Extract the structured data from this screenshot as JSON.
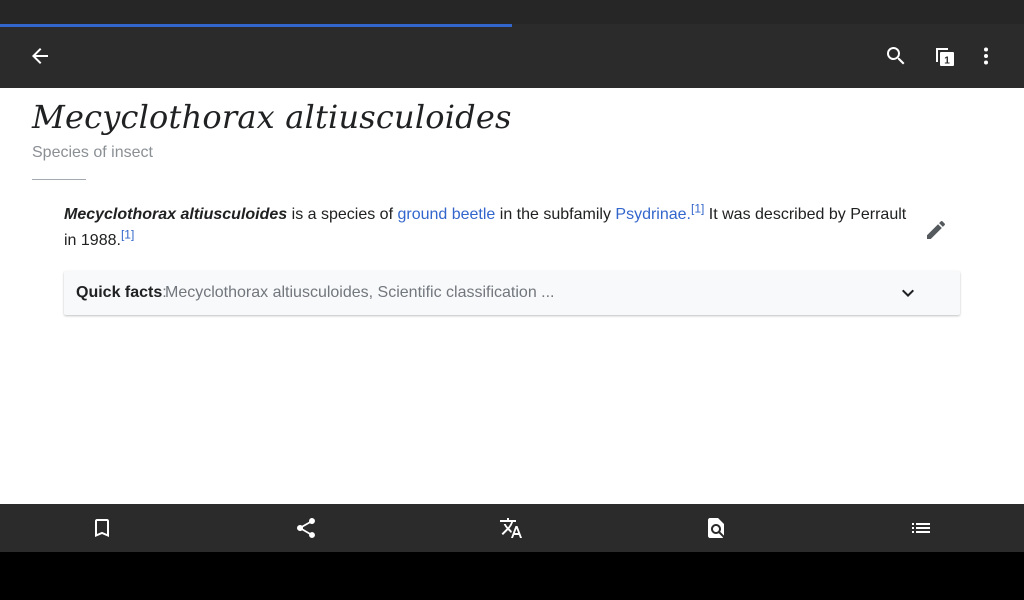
{
  "page_load_progress": 0.5,
  "toolbar": {
    "back_icon": "arrow-back-icon",
    "search_icon": "search-icon",
    "tabs_icon": "tabs-icon",
    "tab_count": "1",
    "overflow_icon": "more-vert-icon"
  },
  "article": {
    "title": "Mecyclothorax altiusculoides",
    "description": "Species of insect",
    "lead": {
      "bold_term": "Mecyclothorax altiusculoides",
      "text1": " is a species of ",
      "link1": "ground beetle",
      "text2": " in the subfamily ",
      "link2": "Psydrinae",
      "text3": ".",
      "ref1": "[1]",
      "text4": " It was described by Perrault in 1988.",
      "ref2": "[1]"
    },
    "edit_icon": "pencil-icon"
  },
  "quick_facts": {
    "label": "Quick facts",
    "separator": ": ",
    "summary": "Mecyclothorax altiusculoides, Scientific classification ...",
    "chevron_icon": "chevron-down-icon"
  },
  "bottom_bar": {
    "items": [
      {
        "name": "save",
        "icon": "bookmark-icon"
      },
      {
        "name": "share",
        "icon": "share-icon"
      },
      {
        "name": "language",
        "icon": "translate-icon"
      },
      {
        "name": "find-in-page",
        "icon": "find-in-page-icon"
      },
      {
        "name": "contents",
        "icon": "list-icon"
      }
    ]
  },
  "colors": {
    "accent": "#3366cc",
    "toolbar": "#2b2b2b",
    "text": "#202122",
    "muted": "#72777d"
  }
}
